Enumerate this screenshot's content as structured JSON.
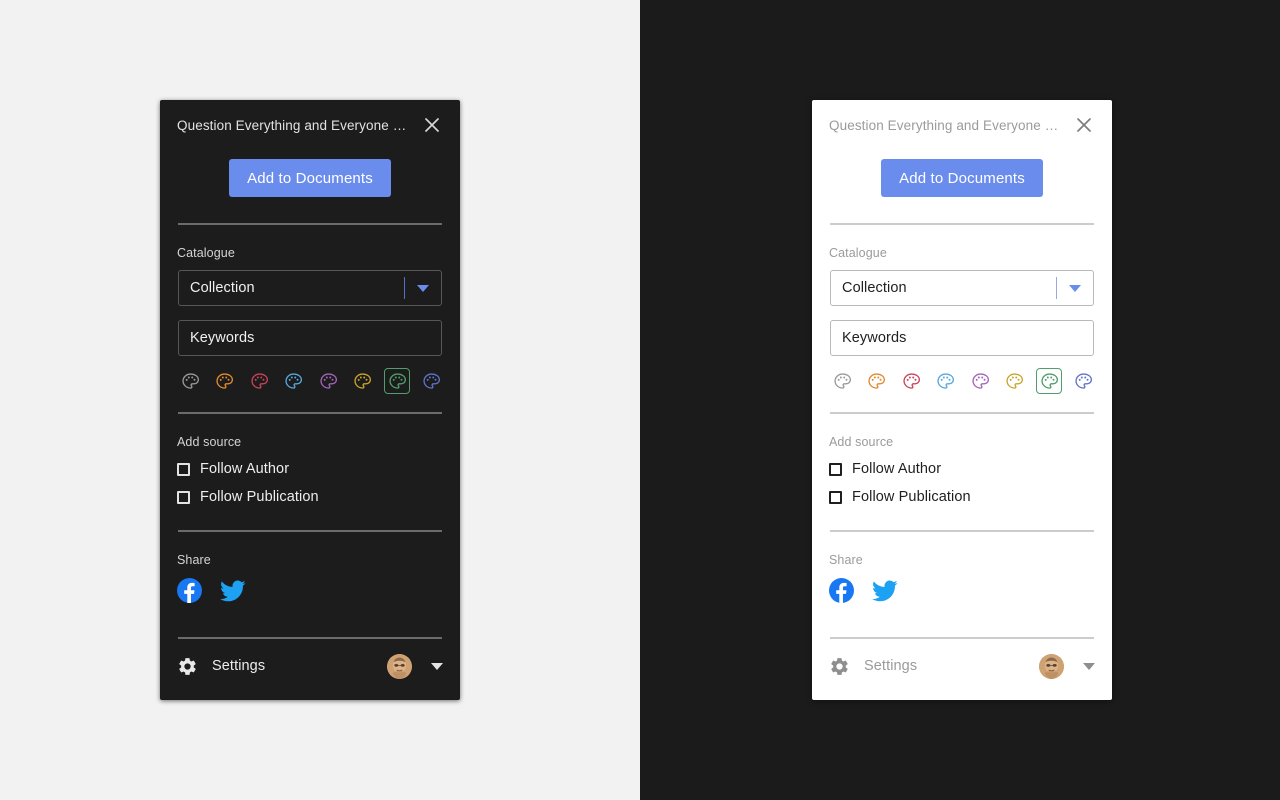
{
  "background": {
    "left_color": "#f2f2f2",
    "right_color": "#1b1b1b"
  },
  "panels": [
    {
      "theme": "dark",
      "header": {
        "title": "Question Everything and Everyone | ...",
        "close_icon": "close-icon"
      },
      "cta": {
        "label": "Add to Documents"
      },
      "catalogue": {
        "section_label": "Catalogue",
        "select_value": "Collection",
        "keywords_value": "Keywords",
        "caret_icon": "chevron-down-icon"
      },
      "palettes": [
        {
          "name": "grey",
          "color": "#9a9a9a",
          "selected": false
        },
        {
          "name": "orange",
          "color": "#e08a2e",
          "selected": false
        },
        {
          "name": "red",
          "color": "#c9445a",
          "selected": false
        },
        {
          "name": "blue",
          "color": "#57a8dd",
          "selected": false
        },
        {
          "name": "purple",
          "color": "#a364b8",
          "selected": false
        },
        {
          "name": "gold",
          "color": "#c9a52c",
          "selected": false
        },
        {
          "name": "green",
          "color": "#4f9e6b",
          "selected": true
        },
        {
          "name": "indigo",
          "color": "#6272c9",
          "selected": false
        }
      ],
      "add_source": {
        "section_label": "Add source",
        "options": [
          {
            "label": "Follow Author",
            "checked": false
          },
          {
            "label": "Follow Publication",
            "checked": false
          }
        ]
      },
      "share": {
        "section_label": "Share",
        "items": [
          {
            "name": "facebook-icon",
            "color": "#1877f2"
          },
          {
            "name": "twitter-icon",
            "color": "#1da1f2"
          }
        ]
      },
      "footer": {
        "settings_label": "Settings",
        "gear_icon": "gear-icon",
        "avatar_name": "avatar",
        "caret_icon": "chevron-down-icon"
      }
    },
    {
      "theme": "light",
      "header": {
        "title": "Question Everything and Everyone | ...",
        "close_icon": "close-icon"
      },
      "cta": {
        "label": "Add to Documents"
      },
      "catalogue": {
        "section_label": "Catalogue",
        "select_value": "Collection",
        "keywords_value": "Keywords",
        "caret_icon": "chevron-down-icon"
      },
      "palettes": [
        {
          "name": "grey",
          "color": "#9a9a9a",
          "selected": false
        },
        {
          "name": "orange",
          "color": "#e08a2e",
          "selected": false
        },
        {
          "name": "red",
          "color": "#c9445a",
          "selected": false
        },
        {
          "name": "blue",
          "color": "#57a8dd",
          "selected": false
        },
        {
          "name": "purple",
          "color": "#a364b8",
          "selected": false
        },
        {
          "name": "gold",
          "color": "#c9a52c",
          "selected": false
        },
        {
          "name": "green",
          "color": "#4f9e6b",
          "selected": true
        },
        {
          "name": "indigo",
          "color": "#6272c9",
          "selected": false
        }
      ],
      "add_source": {
        "section_label": "Add source",
        "options": [
          {
            "label": "Follow Author",
            "checked": false
          },
          {
            "label": "Follow Publication",
            "checked": false
          }
        ]
      },
      "share": {
        "section_label": "Share",
        "items": [
          {
            "name": "facebook-icon",
            "color": "#1877f2"
          },
          {
            "name": "twitter-icon",
            "color": "#1da1f2"
          }
        ]
      },
      "footer": {
        "settings_label": "Settings",
        "gear_icon": "gear-icon",
        "avatar_name": "avatar",
        "caret_icon": "chevron-down-icon"
      }
    }
  ]
}
